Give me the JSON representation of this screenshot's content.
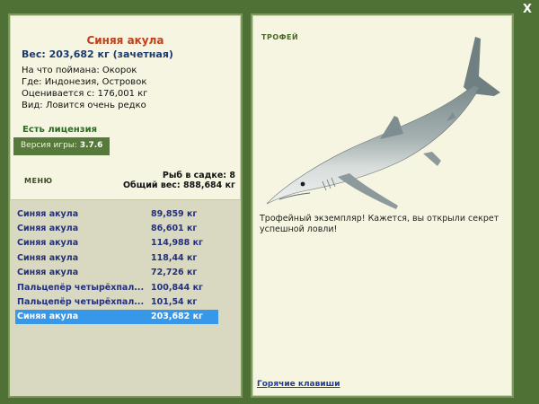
{
  "close_label": "X",
  "fish": {
    "name": "Синяя акула",
    "weight_line": "Вес: 203,682 кг (зачетная)",
    "info": [
      "На что поймана: Окорок",
      "Где: Индонезия, Островок",
      "Оценивается с: 176,001 кг",
      "Вид: Ловится очень редко"
    ]
  },
  "license": "Есть лицензия",
  "version": {
    "label": "Версия игры:",
    "value": "3.7.6"
  },
  "menu_label": "Меню",
  "cage": {
    "count_line": "Рыб в садке: 8",
    "total_line": "Общий вес: 888,684 кг"
  },
  "catches": [
    {
      "name": "Синяя акула",
      "weight": "89,859 кг"
    },
    {
      "name": "Синяя акула",
      "weight": "86,601 кг"
    },
    {
      "name": "Синяя акула",
      "weight": "114,988 кг"
    },
    {
      "name": "Синяя акула",
      "weight": "118,44 кг"
    },
    {
      "name": "Синяя акула",
      "weight": "72,726 кг"
    },
    {
      "name": "Пальцепёр четырёхпал...",
      "weight": "100,844 кг"
    },
    {
      "name": "Пальцепёр четырёхпал...",
      "weight": "101,54 кг"
    },
    {
      "name": "Синяя акула",
      "weight": "203,682 кг",
      "selected": true
    }
  ],
  "trophy": {
    "title": "ТРОФЕЙ",
    "text": "Трофейный экземпляр! Кажется, вы открыли секрет успешной ловли!"
  },
  "hotkeys_label": "Горячие клавиши",
  "colors": {
    "background": "#4f7136",
    "panel": "#f6f5e2",
    "title_red": "#c0401b",
    "selection_blue": "#3797e9",
    "list_text": "#23307a"
  }
}
